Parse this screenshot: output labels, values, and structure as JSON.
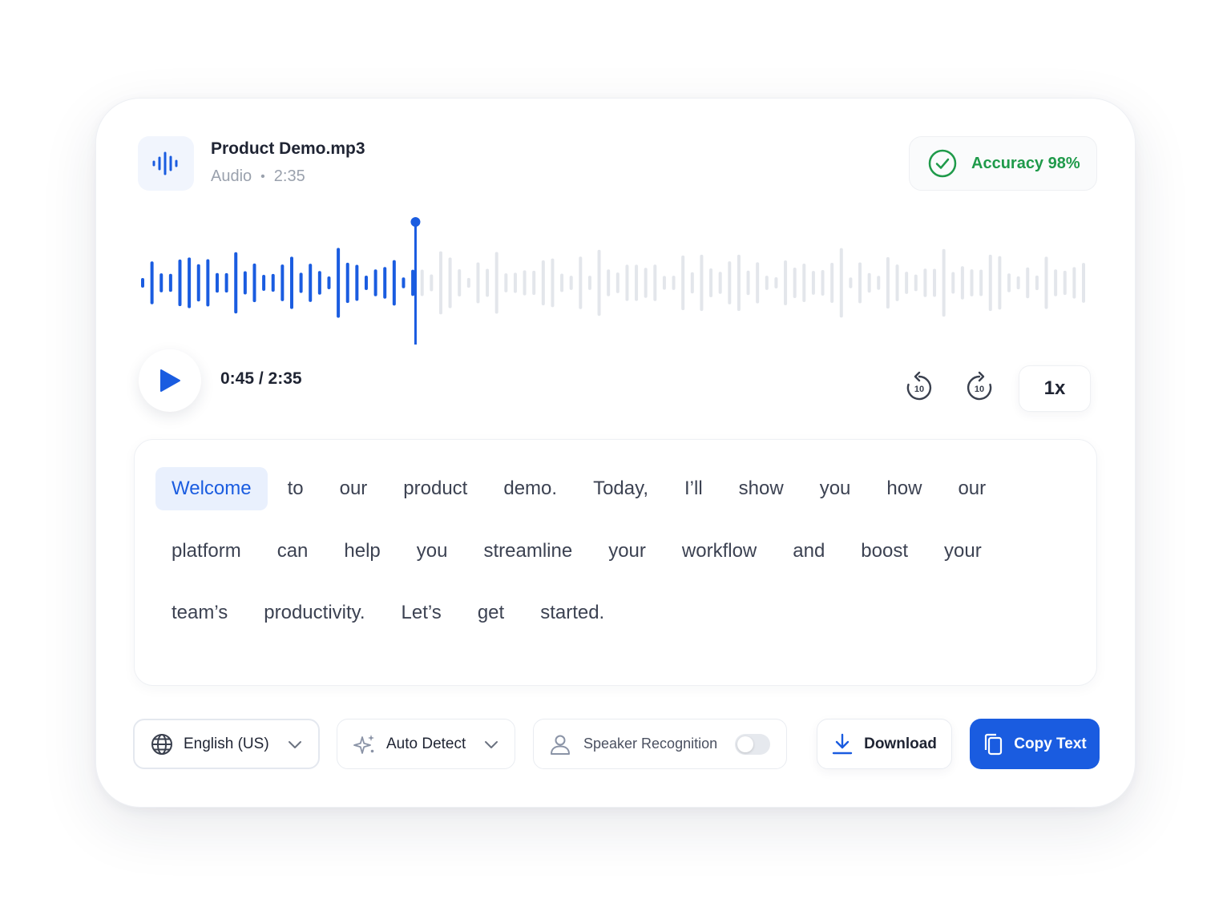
{
  "file": {
    "name": "Product Demo.mp3",
    "type": "Audio",
    "separator": "•",
    "duration": "2:35"
  },
  "accuracy": {
    "label": "Accuracy 98%",
    "value_percent": 98
  },
  "player": {
    "time_display": "0:45 / 2:35",
    "progress_fraction": 0.29,
    "skip_back_seconds": "10",
    "skip_forward_seconds": "10",
    "speed": "1x"
  },
  "transcript": {
    "lines": [
      [
        "Welcome",
        "to",
        "our",
        "product",
        "demo.",
        "Today,",
        "I’ll",
        "show",
        "you",
        "how",
        "our"
      ],
      [
        "platform",
        "can",
        "help",
        "you",
        "streamline",
        "your",
        "workflow",
        "and",
        "boost",
        "your"
      ],
      [
        "team’s",
        "productivity.",
        "Let’s",
        "get",
        "started."
      ]
    ],
    "active_word_index": 0
  },
  "controls": {
    "language": "English (US)",
    "detect": "Auto Detect",
    "speaker": "Speaker Recognition",
    "speaker_enabled": false,
    "download": "Download",
    "copy": "Copy Text"
  },
  "colors": {
    "accent": "#1a5ce0",
    "success": "#1f9a4a",
    "wave_inactive": "#e3e6eb"
  },
  "icons": {
    "file": "waveform-icon",
    "accuracy": "check-circle-icon",
    "play": "play-icon",
    "skip_back": "rewind-10-icon",
    "skip_forward": "forward-10-icon",
    "language": "globe-icon",
    "detect": "sparkle-icon",
    "speaker": "user-icon",
    "download": "download-icon",
    "copy": "copy-icon"
  }
}
